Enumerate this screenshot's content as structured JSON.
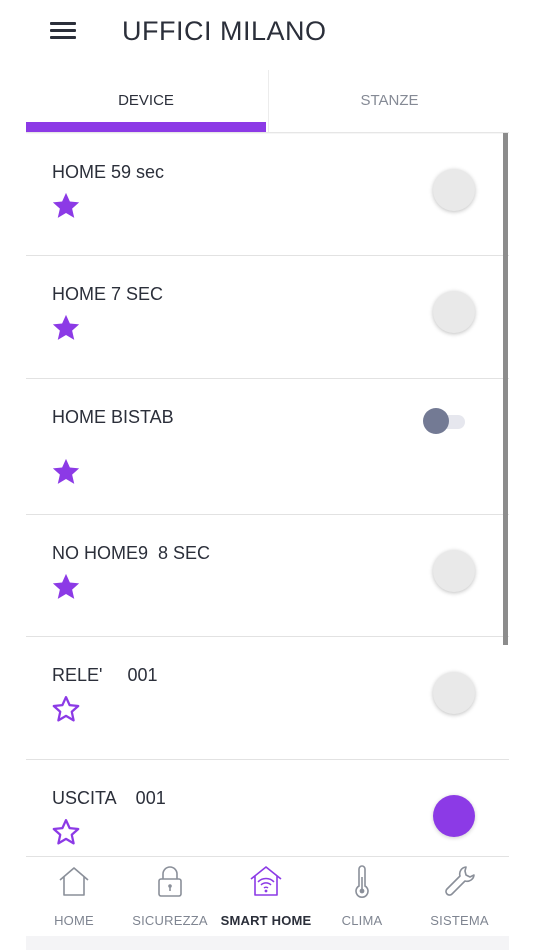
{
  "header": {
    "title": "UFFICI MILANO",
    "menu_icon": "hamburger-menu-icon"
  },
  "tabs": [
    {
      "label": "DEVICE",
      "active": true
    },
    {
      "label": "STANZE",
      "active": false
    }
  ],
  "devices": [
    {
      "name": "HOME 59 sec",
      "favorite": true,
      "control": "button",
      "state": "off"
    },
    {
      "name": "HOME 7 SEC",
      "favorite": true,
      "control": "button",
      "state": "off"
    },
    {
      "name": "HOME BISTAB",
      "favorite": true,
      "control": "toggle",
      "state": "off"
    },
    {
      "name": "NO HOME9  8 SEC",
      "favorite": true,
      "control": "button",
      "state": "off"
    },
    {
      "name": "RELE'     001",
      "favorite": false,
      "control": "button",
      "state": "off"
    },
    {
      "name": "USCITA    001",
      "favorite": false,
      "control": "button",
      "state": "on"
    }
  ],
  "bottom_nav": [
    {
      "label": "HOME",
      "icon": "house-icon",
      "active": false
    },
    {
      "label": "SICUREZZA",
      "icon": "padlock-icon",
      "active": false
    },
    {
      "label": "SMART HOME",
      "icon": "smart-home-wifi-icon",
      "active": true
    },
    {
      "label": "CLIMA",
      "icon": "thermometer-icon",
      "active": false
    },
    {
      "label": "SISTEMA",
      "icon": "wrench-icon",
      "active": false
    }
  ],
  "colors": {
    "accent": "#8c3ae6",
    "text": "#2b2f3a",
    "muted": "#858a95",
    "toggle_knob": "#737a94"
  }
}
